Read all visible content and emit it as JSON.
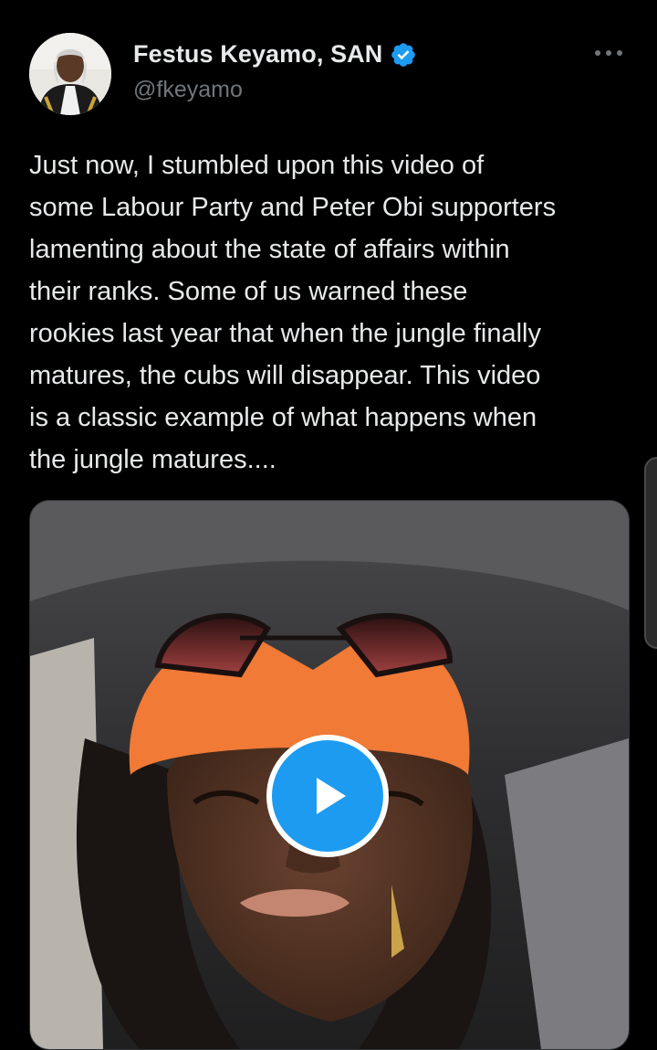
{
  "tweet": {
    "author": {
      "display_name": "Festus Keyamo, SAN",
      "handle": "@fkeyamo",
      "verified": true,
      "avatar_icon": "profile-photo"
    },
    "more_icon": "more-options-icon",
    "text": "Just now, I stumbled upon this video of\nsome Labour Party and Peter Obi supporters\nlamenting about the state of affairs within\ntheir ranks. Some of us warned these\nrookies last year that when the jungle finally\nmatures, the cubs will disappear. This video\nis a classic example of what happens when\nthe jungle matures....",
    "media": {
      "type": "video",
      "play_icon": "play-icon"
    }
  },
  "colors": {
    "background": "#000000",
    "text_primary": "#e7e9ea",
    "text_secondary": "#71767b",
    "accent": "#1d9bf0",
    "border": "#2f3336"
  }
}
